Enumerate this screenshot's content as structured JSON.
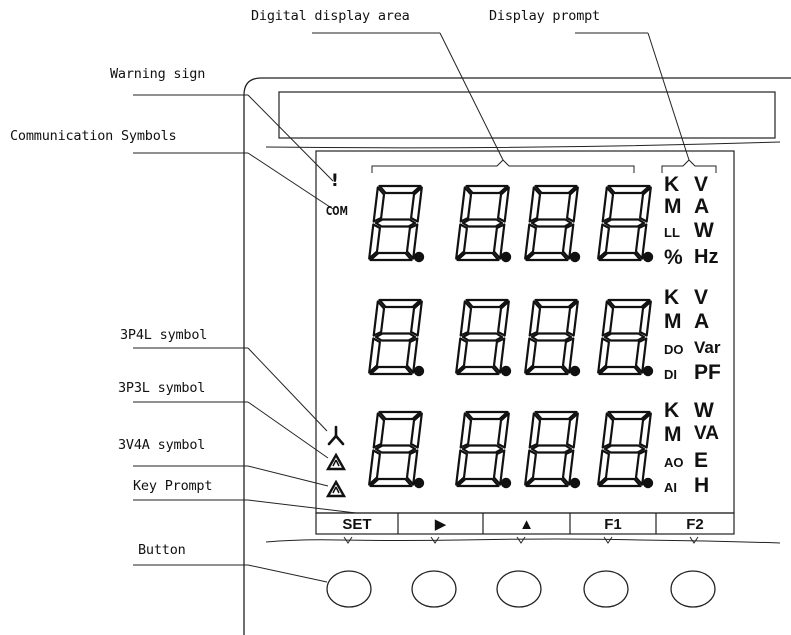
{
  "labels": {
    "digital_display_area": "Digital display area",
    "display_prompt": "Display prompt",
    "warning_sign": "Warning sign",
    "communication_symbols": "Communication Symbols",
    "p4l_symbol": "3P4L symbol",
    "p3l_symbol": "3P3L symbol",
    "v4a_symbol": "3V4A symbol",
    "key_prompt": "Key Prompt",
    "button": "Button"
  },
  "indicators": {
    "warning": "!",
    "communication": "COM"
  },
  "digits": {
    "row1": "8.8.8.8.",
    "row2": "8.8.8.8.",
    "row3": "8.8.8.8."
  },
  "units": {
    "row1": [
      [
        "K",
        "V"
      ],
      [
        "M",
        "A"
      ],
      [
        "LL",
        "W"
      ],
      [
        "%",
        "Hz"
      ]
    ],
    "row2": [
      [
        "K",
        "V"
      ],
      [
        "M",
        "A"
      ],
      [
        "DO",
        "Var"
      ],
      [
        "DI",
        "PF"
      ]
    ],
    "row3": [
      [
        "K",
        "W"
      ],
      [
        "M",
        "VA"
      ],
      [
        "AO",
        "E"
      ],
      [
        "AI",
        "H"
      ]
    ]
  },
  "keys": [
    "SET",
    "▶",
    "▲",
    "F1",
    "F2"
  ],
  "buttons": [
    "button-1",
    "button-2",
    "button-3",
    "button-4",
    "button-5"
  ]
}
